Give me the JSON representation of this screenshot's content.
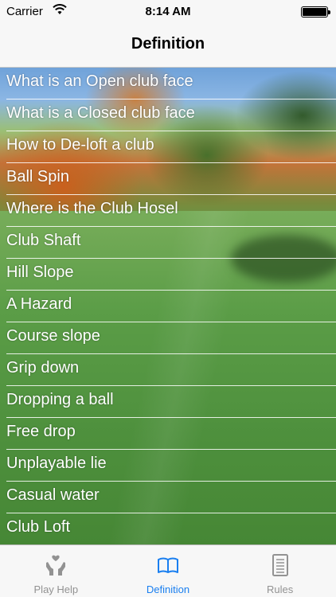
{
  "status_bar": {
    "carrier": "Carrier",
    "time": "8:14 AM"
  },
  "nav": {
    "title": "Definition"
  },
  "definitions": [
    {
      "label": "What is an Open club face"
    },
    {
      "label": "What is a Closed club face"
    },
    {
      "label": "How to De-loft a club"
    },
    {
      "label": "Ball Spin"
    },
    {
      "label": "Where is the Club Hosel"
    },
    {
      "label": "Club Shaft"
    },
    {
      "label": "Hill Slope"
    },
    {
      "label": "A Hazard"
    },
    {
      "label": "Course slope"
    },
    {
      "label": "Grip down"
    },
    {
      "label": "Dropping a ball"
    },
    {
      "label": "Free drop"
    },
    {
      "label": "Unplayable lie"
    },
    {
      "label": "Casual water"
    },
    {
      "label": "Club Loft"
    }
  ],
  "tabs": [
    {
      "label": "Play Help",
      "icon": "hands-heart-icon",
      "active": false
    },
    {
      "label": "Definition",
      "icon": "open-book-icon",
      "active": true
    },
    {
      "label": "Rules",
      "icon": "document-list-icon",
      "active": false
    }
  ],
  "colors": {
    "active_tab": "#1a7ff0",
    "inactive_tab": "#929292"
  }
}
